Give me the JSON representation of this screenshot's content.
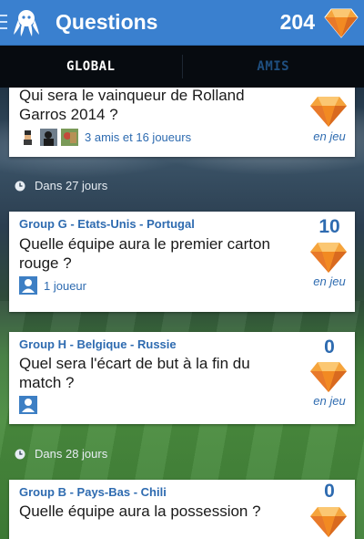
{
  "header": {
    "title": "Questions",
    "points": "204",
    "menu_icon": "hamburger-icon",
    "logo_icon": "octopus-logo",
    "gem_icon": "diamond-icon",
    "colors": {
      "bar": "#3a80cf",
      "gem": "#f28a22"
    }
  },
  "tabs": [
    {
      "label": "GLOBAL",
      "active": true
    },
    {
      "label": "AMIS",
      "active": false
    }
  ],
  "cards": [
    {
      "group": "",
      "question": "Qui sera le vainqueur de Rolland Garros 2014 ?",
      "score": "",
      "status": "en jeu",
      "meta": "3 amis et 16 joueurs"
    },
    {
      "group": "Group G - Etats-Unis - Portugal",
      "question": "Quelle équipe aura le premier carton rouge ?",
      "score": "10",
      "status": "en jeu",
      "meta": "1 joueur"
    },
    {
      "group": "Group H - Belgique - Russie",
      "question": "Quel sera l'écart de but à la fin du match ?",
      "score": "0",
      "status": "en jeu",
      "meta": ""
    },
    {
      "group": "Group B - Pays-Bas - Chili",
      "question": "Quelle équipe aura la possession ?",
      "score": "0",
      "status": "",
      "meta": ""
    }
  ],
  "day_separators": [
    "Dans 27 jours",
    "Dans 28 jours"
  ]
}
